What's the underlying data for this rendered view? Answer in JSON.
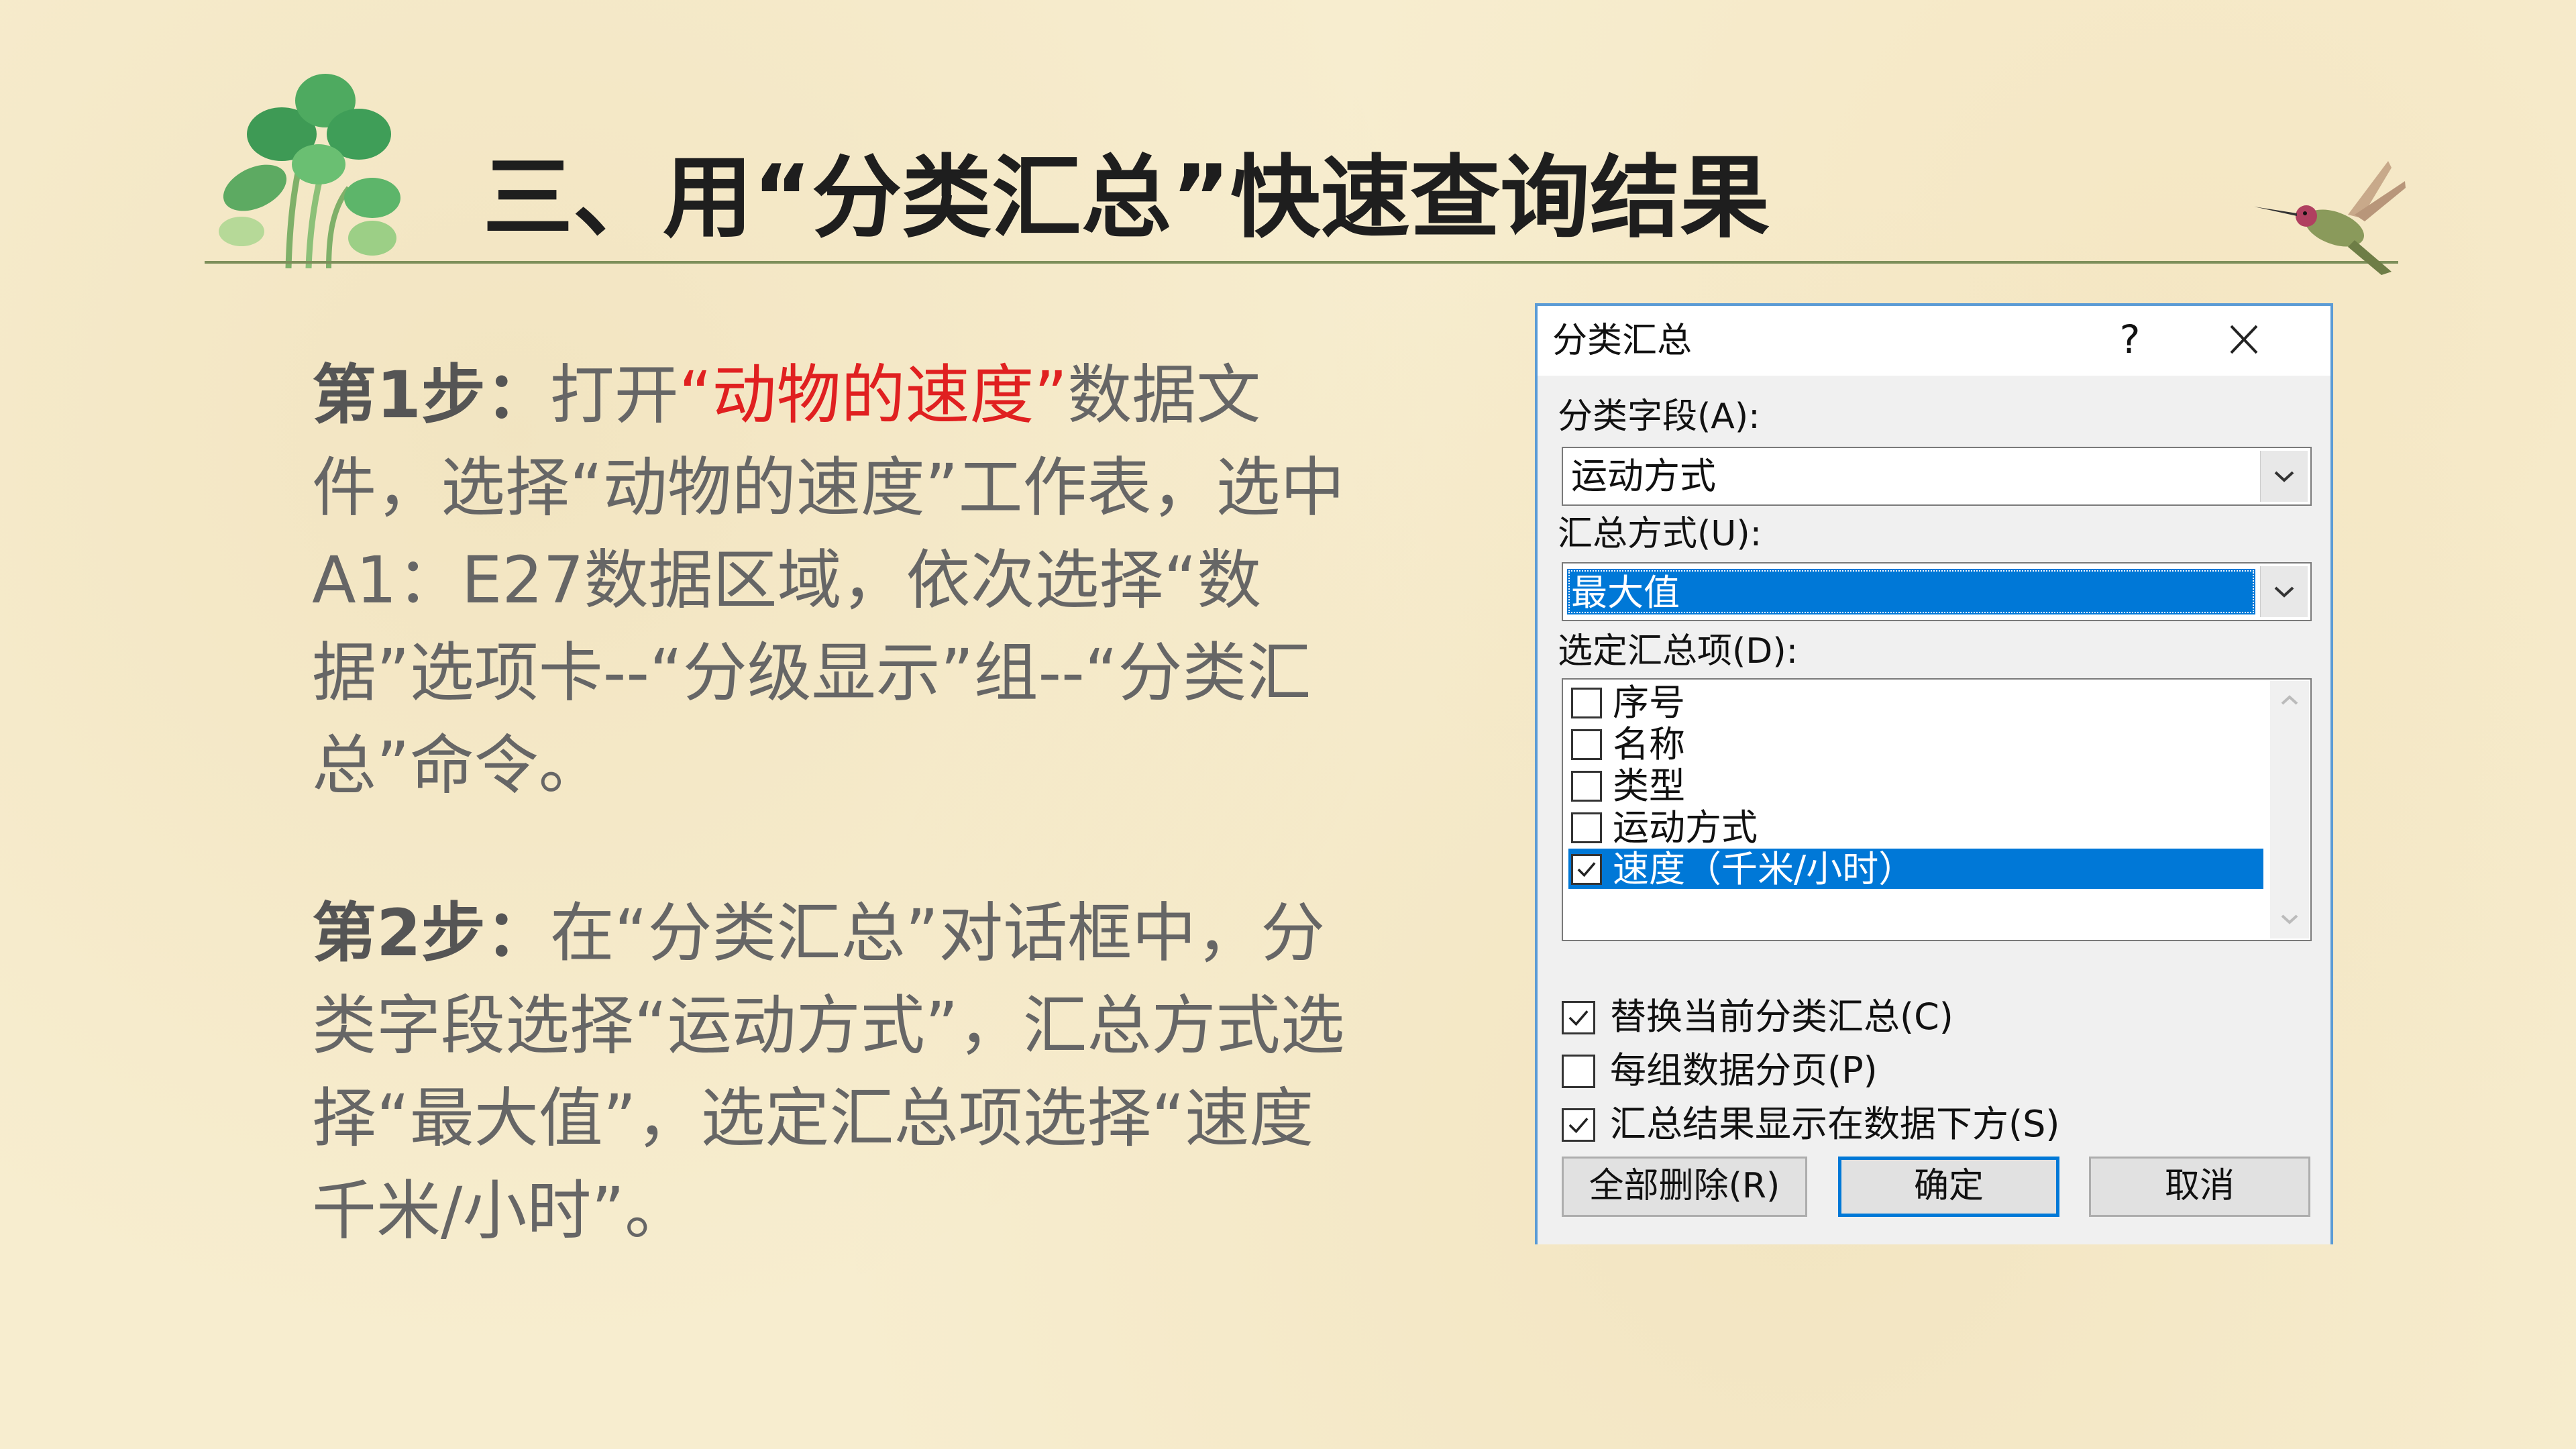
{
  "slide": {
    "title": "三、用“分类汇总”快速查询结果",
    "step1": {
      "label": "第1步：",
      "text_a": "打开",
      "highlight": "“动物的速度”",
      "text_b": "数据文件，选择“动物的速度”工作表，选中A1：E27数据区域，依次选择“数据”选项卡--“分级显示”组--“分类汇总”命令。"
    },
    "step2": {
      "label": "第2步：",
      "text": "在“分类汇总”对话框中，分类字段选择“运动方式”，汇总方式选择“最大值”，选定汇总项选择“速度 千米/小时”。"
    },
    "colors": {
      "highlight": "#e02020",
      "dialog_border": "#5b9bd5",
      "selection": "#0078d7"
    }
  },
  "dialog": {
    "title": "分类汇总",
    "help": "?",
    "field_label": "分类字段(A):",
    "field_value": "运动方式",
    "method_label": "汇总方式(U):",
    "method_value": "最大值",
    "items_label": "选定汇总项(D):",
    "items": [
      {
        "label": "序号",
        "checked": false,
        "selected": false
      },
      {
        "label": "名称",
        "checked": false,
        "selected": false
      },
      {
        "label": "类型",
        "checked": false,
        "selected": false
      },
      {
        "label": "运动方式",
        "checked": false,
        "selected": false
      },
      {
        "label": "速度（千米/小时）",
        "checked": true,
        "selected": true
      }
    ],
    "options": [
      {
        "label": "替换当前分类汇总(C)",
        "checked": true
      },
      {
        "label": "每组数据分页(P)",
        "checked": false
      },
      {
        "label": "汇总结果显示在数据下方(S)",
        "checked": true
      }
    ],
    "buttons": {
      "remove_all": "全部删除(R)",
      "ok": "确定",
      "cancel": "取消"
    }
  }
}
